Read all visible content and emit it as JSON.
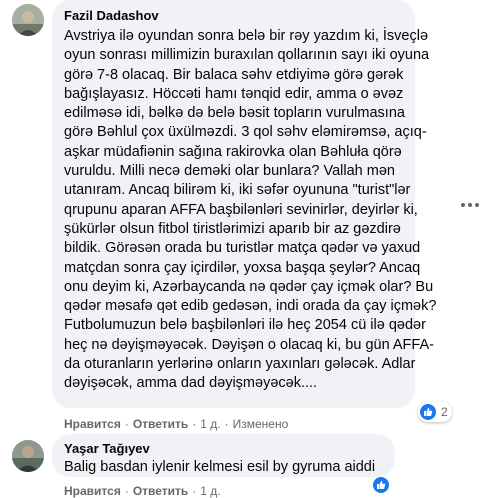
{
  "comments": [
    {
      "author": "Fazil Dadashov",
      "lines": [
        "Avstriya ilə oyundan sonra belə bir rəy yazdım ki, İsveçlə",
        "oyun sonrası millimizin buraxılan qollarının sayı iki oyuna",
        "görə 7-8 olacaq. Bir balaca səhv etdiyimə görə gərək",
        "bağışlayasız. Höccəti hamı tənqid edir, amma o əvəz",
        "edilməsə idi, bəlkə də belə bəsit topların vurulmasına",
        "görə Bəhlul çox üxülməzdi. 3 qol səhv eləmirəmsə, açıq-",
        "aşkar müdafiənin sağına rakirovka olan Bəhluła qörə",
        "vuruldu. Milli necə deməki olar bunlara? Vallah mən",
        "utanıram. Ancaq bilirəm ki, iki səfər oyununa \"turist\"lər",
        "qrupunu aparan AFFA başbilənləri sevinirlər, deyirlər ki,",
        "şükürlər olsun fitbol tiristlərimizi aparıb bir az gəzdirə",
        "bildik. Görəsən orada bu turistlər matça qədər və yaxud",
        "matçdan sonra çay içirdilər, yoxsa başqa şeylər? Ancaq",
        "onu deyim ki, Azərbaycanda nə qədər çay içmək olar? Bu",
        "qədər məsafə qət edib gedəsən, indi orada da çay içmək?",
        "Futbolumuzun belə başbilənləri ilə heç 2054 cü ilə qədər",
        "heç nə dəyişməyəcək. Dəyişən o olacaq ki, bu gün AFFA-",
        "da oturanların yerlərinə onların yaxınları gələcək. Adlar",
        "dəyişəcək, amma dad dəyişməyəcək...."
      ],
      "actions": {
        "like": "Нравится",
        "reply": "Ответить",
        "time": "1 д.",
        "edited": "Изменено"
      },
      "reactions": {
        "count": "2"
      }
    },
    {
      "author": "Yaşar Tağıyev",
      "lines": [
        "Balig basdan iylenir kelmesi esil by gyruma aiddi"
      ],
      "actions": {
        "like": "Нравится",
        "reply": "Ответить",
        "time": "1 д."
      }
    }
  ],
  "colors": {
    "bubble": "#f0f2f5",
    "meta": "#65676b",
    "like": "#1877f2"
  }
}
